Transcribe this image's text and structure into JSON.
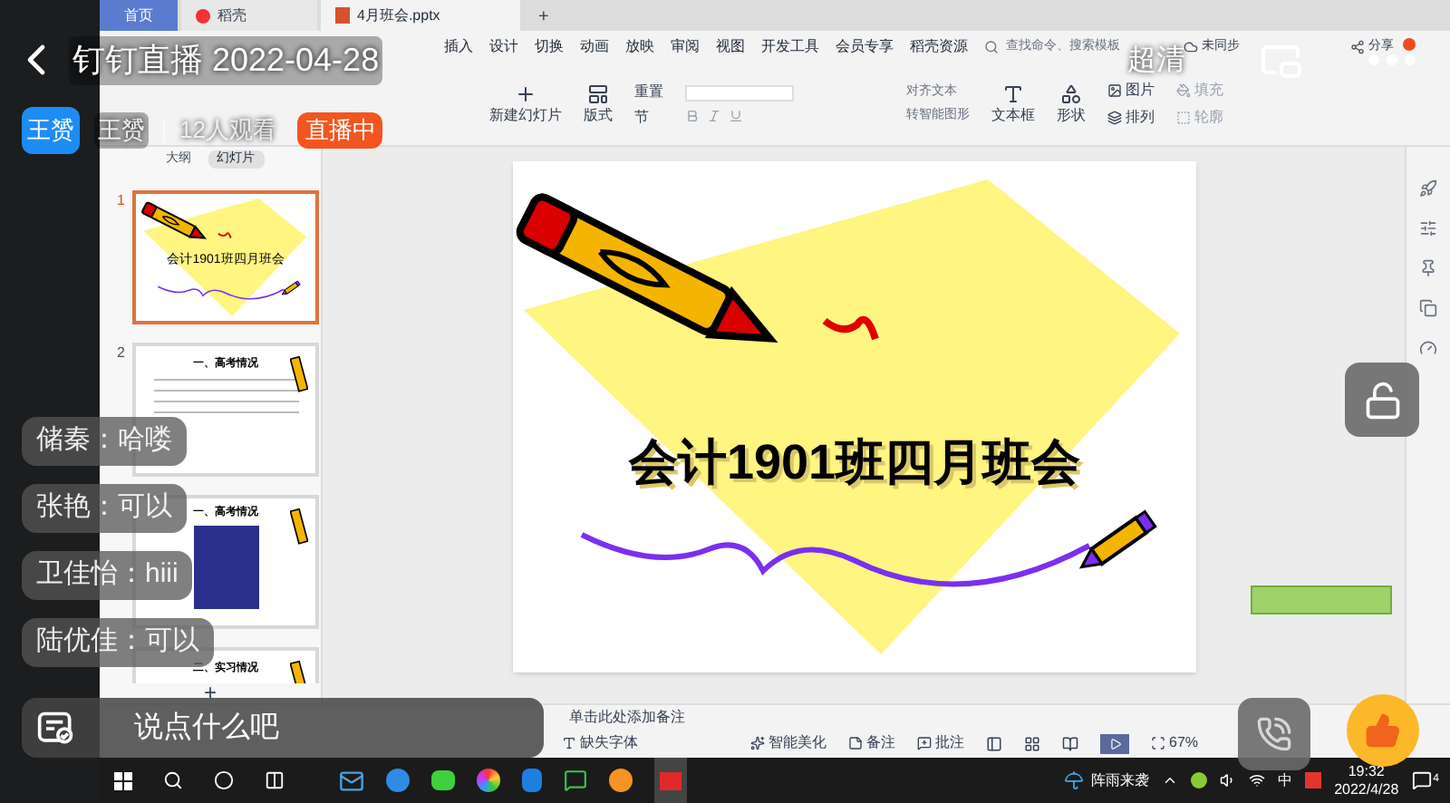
{
  "stream": {
    "title": "钉钉直播 2022-04-28",
    "host_badge": "王赟",
    "host": "王赟",
    "viewers": "12人观看",
    "live_badge": "直播中",
    "quality": "超清"
  },
  "chat": [
    {
      "text": "储秦：哈喽"
    },
    {
      "text": "张艳：可以"
    },
    {
      "text": "卫佳怡：hiii"
    },
    {
      "text": "陆优佳：可以"
    }
  ],
  "comment_box": {
    "placeholder": "说点什么吧"
  },
  "app": {
    "tabs": [
      {
        "label": "首页",
        "selected": false,
        "kind": "home"
      },
      {
        "label": "稻壳",
        "selected": false,
        "kind": "docer"
      },
      {
        "label": "4月班会.pptx",
        "selected": true,
        "kind": "file"
      }
    ],
    "new_tab": "+",
    "menu": [
      "插入",
      "设计",
      "切换",
      "动画",
      "放映",
      "审阅",
      "视图",
      "开发工具",
      "会员专享",
      "稻壳资源"
    ],
    "search": {
      "placeholder": "查找命令、搜索模板"
    },
    "sync": "未同步",
    "share": "分享",
    "ribbon": {
      "new_slide": "新建幻灯片",
      "layout": "版式",
      "section": "节",
      "reset": "重置",
      "align_text": "对齐文本",
      "smart_art": "转智能图形",
      "textbox": "文本框",
      "shape": "形状",
      "arrange": "排列",
      "picture": "图片",
      "fill": "填充",
      "outline": "轮廓"
    },
    "panel_tabs": [
      {
        "label": "大纲",
        "selected": false
      },
      {
        "label": "幻灯片",
        "selected": true
      }
    ],
    "slides": [
      {
        "number": "1",
        "selected": true,
        "kind": "title",
        "title": "会计1901班四月班会"
      },
      {
        "number": "2",
        "selected": false,
        "kind": "list",
        "title": "一、高考情况"
      },
      {
        "selected": false,
        "kind": "poster",
        "title": "一、高考情况"
      },
      {
        "selected": false,
        "kind": "list",
        "title": "二、实习情况"
      }
    ],
    "add_slide": "+",
    "canvas": {
      "title": "会计1901班四月班会"
    },
    "notes": {
      "placeholder": "单击此处添加备注"
    },
    "status": {
      "missing_font": "缺失字体",
      "beautify": "智能美化",
      "notes": "备注",
      "comments": "批注",
      "zoom": "67%"
    }
  },
  "taskbar": {
    "weather": "阵雨来袭",
    "ime": "中",
    "time": "19:32",
    "date": "2022/4/28",
    "notifications": "4"
  }
}
